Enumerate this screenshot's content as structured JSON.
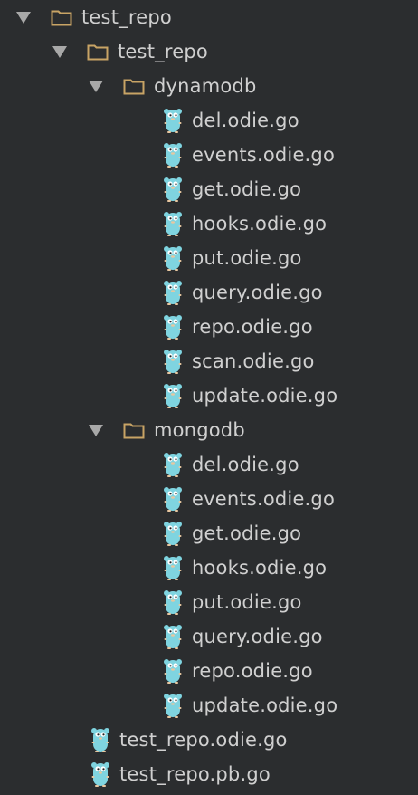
{
  "tree": {
    "root": {
      "label": "test_repo",
      "children": {
        "sub": {
          "label": "test_repo",
          "dynamodb": {
            "label": "dynamodb",
            "files": [
              "del.odie.go",
              "events.odie.go",
              "get.odie.go",
              "hooks.odie.go",
              "put.odie.go",
              "query.odie.go",
              "repo.odie.go",
              "scan.odie.go",
              "update.odie.go"
            ]
          },
          "mongodb": {
            "label": "mongodb",
            "files": [
              "del.odie.go",
              "events.odie.go",
              "get.odie.go",
              "hooks.odie.go",
              "put.odie.go",
              "query.odie.go",
              "repo.odie.go",
              "update.odie.go"
            ]
          }
        },
        "files": [
          "test_repo.odie.go",
          "test_repo.pb.go"
        ]
      }
    },
    "colors": {
      "background": "#2b2d2f",
      "text": "#d0d0d0",
      "folder": "#c8a465",
      "gopher": "#7fd4e0",
      "arrow": "#a8a8a8"
    },
    "icons": {
      "folder": "folder-icon",
      "go_file": "gopher-icon",
      "expand": "expand-arrow-icon"
    }
  }
}
